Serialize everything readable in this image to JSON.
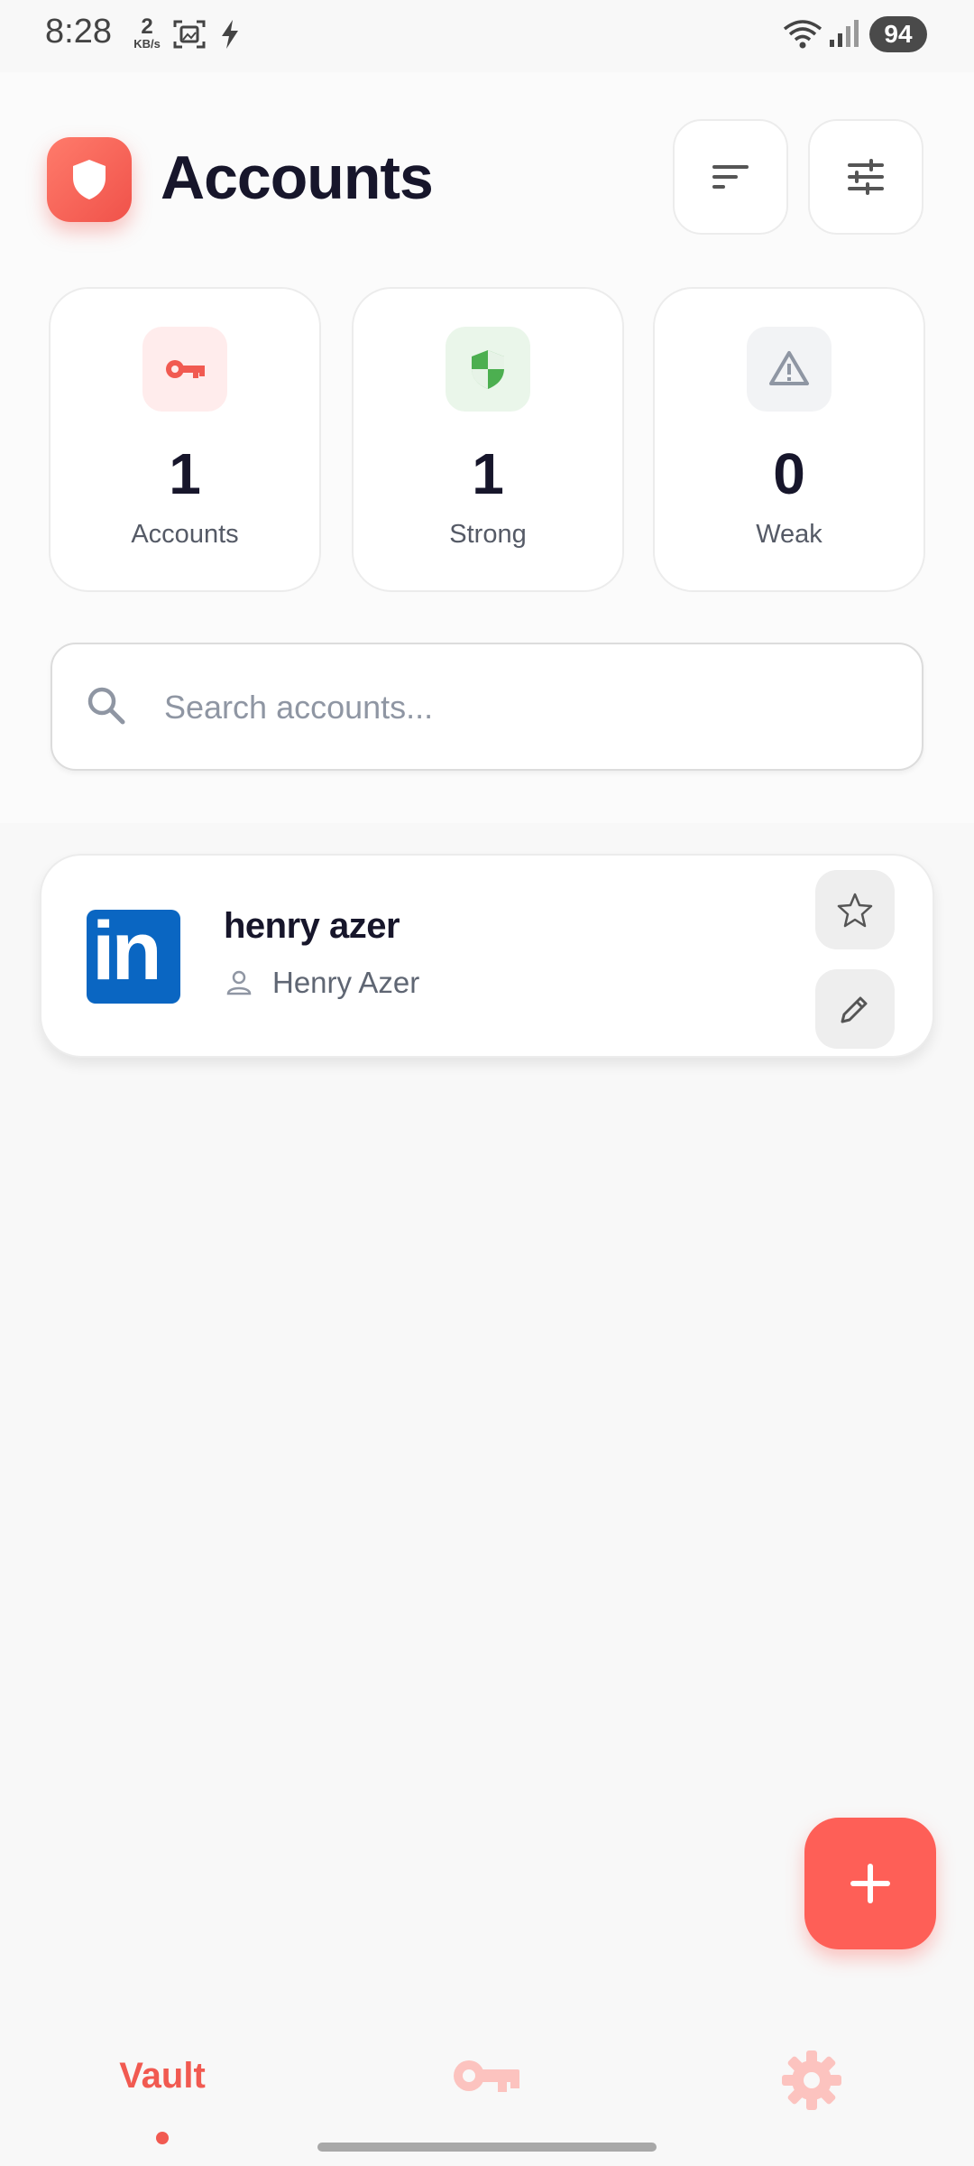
{
  "status_bar": {
    "time": "8:28",
    "net_speed_value": "2",
    "net_speed_unit": "KB/s",
    "battery": "94",
    "icons": [
      "screenshot-icon",
      "flash-icon",
      "wifi-icon",
      "signal-icon",
      "battery-icon"
    ]
  },
  "header": {
    "title": "Accounts",
    "logo_icon": "shield-icon",
    "sort_icon": "sort-icon",
    "filter_icon": "sliders-icon"
  },
  "stats": [
    {
      "value": "1",
      "label": "Accounts",
      "icon": "key-icon",
      "color": "#f15a51",
      "bg": "#ffecec"
    },
    {
      "value": "1",
      "label": "Strong",
      "icon": "shield-check-icon",
      "color": "#4caf50",
      "bg": "#eaf6ea"
    },
    {
      "value": "0",
      "label": "Weak",
      "icon": "warning-icon",
      "color": "#8f96a3",
      "bg": "#f2f3f5"
    }
  ],
  "search": {
    "placeholder": "Search accounts...",
    "value": ""
  },
  "accounts": [
    {
      "name": "henry azer",
      "username": "Henry Azer",
      "logo_text": "in",
      "logo_color": "#0a66c2"
    }
  ],
  "bottom_nav": {
    "vault_label": "Vault",
    "active": "vault",
    "accent": "#f15a51"
  },
  "colors": {
    "accent": "#fe5f57",
    "title": "#17162b",
    "muted": "#5f6673"
  }
}
